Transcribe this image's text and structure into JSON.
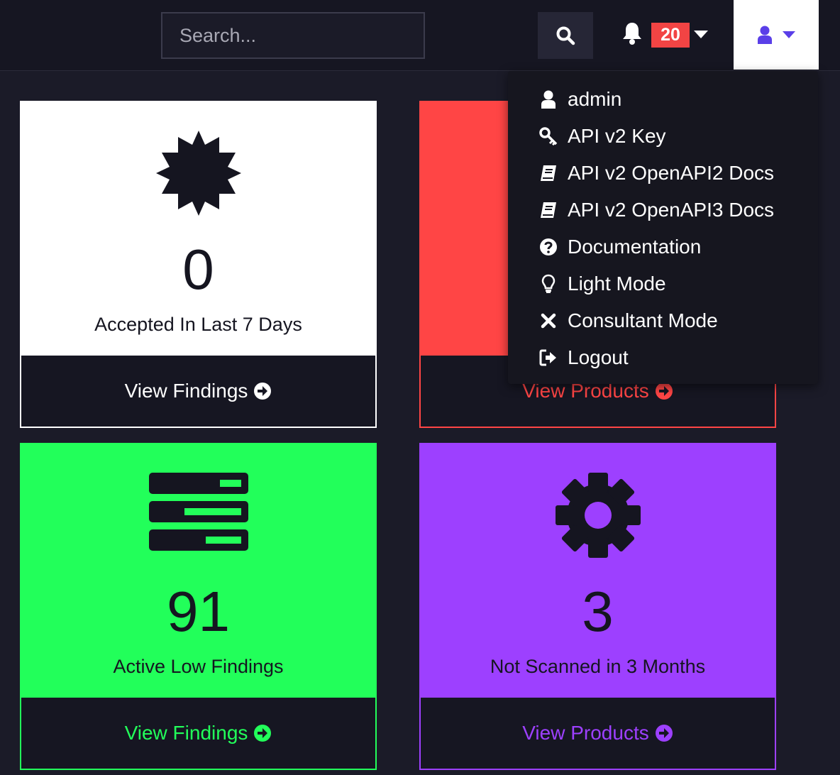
{
  "navbar": {
    "search_placeholder": "Search...",
    "notification_count": "20",
    "user_icon_color": "#5a3fe8"
  },
  "user_menu": {
    "items": [
      {
        "label": "admin",
        "icon": "user-icon"
      },
      {
        "label": "API v2 Key",
        "icon": "key-icon"
      },
      {
        "label": "API v2 OpenAPI2 Docs",
        "icon": "book-icon"
      },
      {
        "label": "API v2 OpenAPI3 Docs",
        "icon": "book-icon"
      },
      {
        "label": "Documentation",
        "icon": "question-circle-icon"
      },
      {
        "label": "Light Mode",
        "icon": "lightbulb-icon"
      },
      {
        "label": "Consultant Mode",
        "icon": "x-icon"
      },
      {
        "label": "Logout",
        "icon": "sign-out-icon"
      }
    ]
  },
  "cards": [
    {
      "count": "0",
      "label": "Accepted In Last 7 Days",
      "link": "View Findings",
      "color": "#ffffff",
      "accent": "#ffffff",
      "icon": "certificate-icon"
    },
    {
      "count": "",
      "label": "",
      "link": "View Products",
      "color": "#ff4545",
      "accent": "#ff4545",
      "icon": ""
    },
    {
      "count": "91",
      "label": "Active Low Findings",
      "link": "View Findings",
      "color": "#22ff5a",
      "accent": "#22ff5a",
      "icon": "server-icon"
    },
    {
      "count": "3",
      "label": "Not Scanned in 3 Months",
      "link": "View Products",
      "color": "#9d40ff",
      "accent": "#9d40ff",
      "icon": "gear-icon"
    }
  ]
}
